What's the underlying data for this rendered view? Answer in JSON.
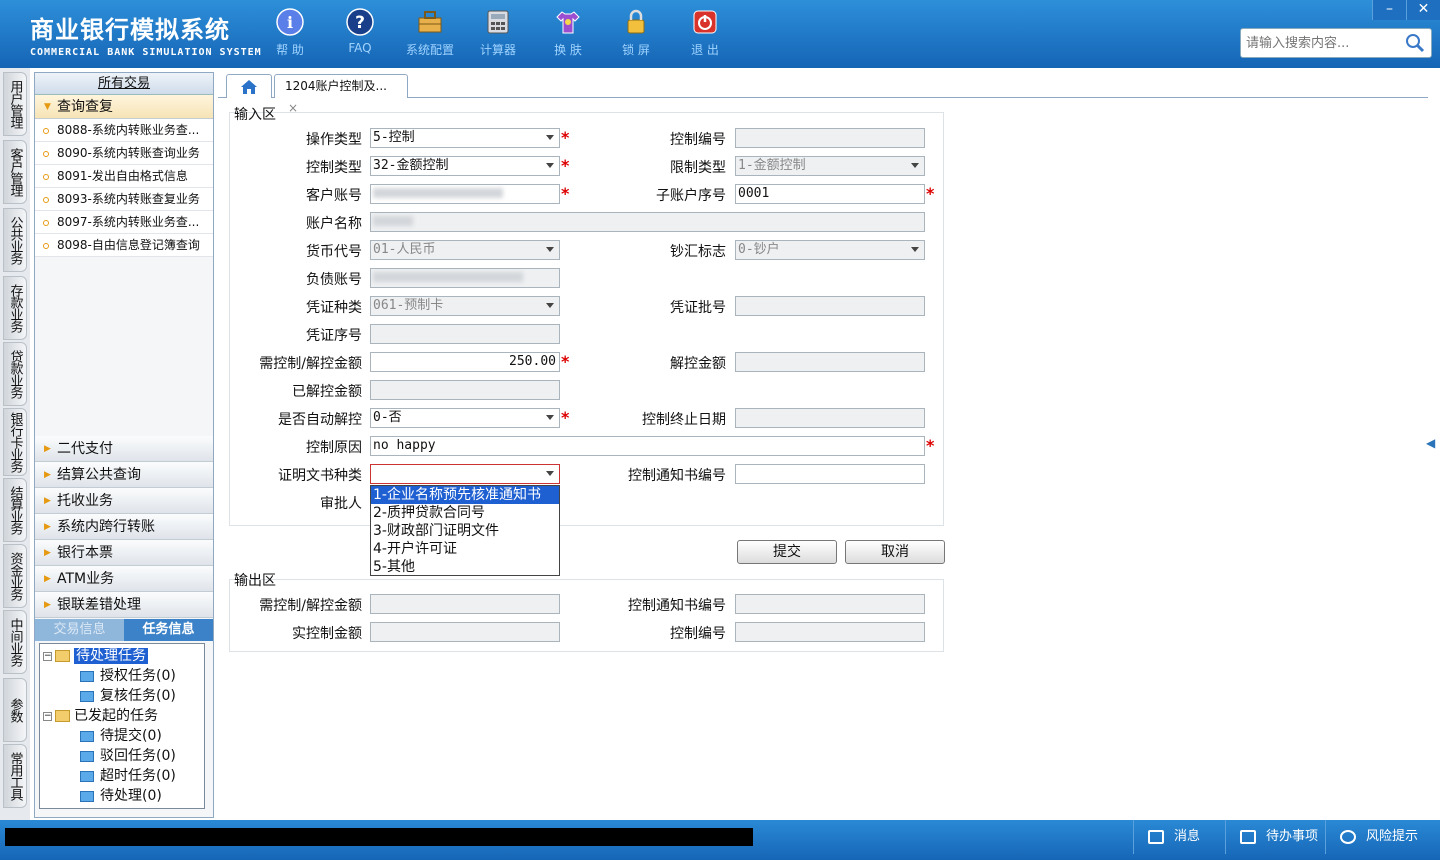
{
  "header": {
    "title_cn": "商业银行模拟系统",
    "title_en": "COMMERCIAL BANK SIMULATION SYSTEM",
    "toolbar": [
      {
        "label": "帮 助",
        "icon": "info-icon"
      },
      {
        "label": "FAQ",
        "icon": "help-icon"
      },
      {
        "label": "系统配置",
        "icon": "toolbox-icon"
      },
      {
        "label": "计算器",
        "icon": "calculator-icon"
      },
      {
        "label": "换 肤",
        "icon": "tshirt-icon"
      },
      {
        "label": "锁 屏",
        "icon": "lock-icon"
      },
      {
        "label": "退 出",
        "icon": "power-icon"
      }
    ],
    "window_controls": {
      "minimize": "–",
      "close": "✕"
    },
    "search_placeholder": "请输入搜索内容..."
  },
  "vertical_tabs": [
    "用户管理",
    "客户管理",
    "公共业务",
    "存款业务",
    "贷款业务",
    "银行卡业务",
    "结算业务",
    "资金业务",
    "中间业务",
    "参数",
    "常用工具"
  ],
  "left_panel": {
    "title": "所有交易",
    "open_group": "查询查复",
    "open_items": [
      "8088-系统内转账业务查...",
      "8090-系统内转账查询业务",
      "8091-发出自由格式信息",
      "8093-系统内转账查复业务",
      "8097-系统内转账业务查...",
      "8098-自由信息登记簿查询"
    ],
    "collapsed_groups": [
      "二代支付",
      "结算公共查询",
      "托收业务",
      "系统内跨行转账",
      "银行本票",
      "ATM业务",
      "银联差错处理"
    ],
    "task_tabs": {
      "left": "交易信息",
      "right": "任务信息"
    },
    "tree": {
      "pending": "待处理任务",
      "pending_children": [
        "授权任务(0)",
        "复核任务(0)"
      ],
      "initiated": "已发起的任务",
      "initiated_children": [
        "待提交(0)",
        "驳回任务(0)",
        "超时任务(0)",
        "待处理(0)"
      ]
    }
  },
  "tabs": {
    "active": "1204账户控制及...",
    "close": "×"
  },
  "form": {
    "input_section": "输入区",
    "output_section": "输出区",
    "labels": {
      "op_type": "操作类型",
      "ctrl_no": "控制编号",
      "ctrl_type": "控制类型",
      "limit_type": "限制类型",
      "cust_acct": "客户账号",
      "sub_acct_seq": "子账户序号",
      "acct_name": "账户名称",
      "currency": "货币代号",
      "cash_flag": "钞汇标志",
      "debt_acct": "负债账号",
      "voucher_type": "凭证种类",
      "voucher_batch": "凭证批号",
      "voucher_seq": "凭证序号",
      "ctrl_amount": "需控制/解控金额",
      "release_amount": "解控金额",
      "released_amount": "已解控金额",
      "auto_release": "是否自动解控",
      "ctrl_end_date": "控制终止日期",
      "ctrl_reason": "控制原因",
      "doc_type": "证明文书种类",
      "notice_no": "控制通知书编号",
      "approver": "审批人"
    },
    "values": {
      "op_type": "5-控制",
      "ctrl_type": "32-金额控制",
      "limit_type": "1-金额控制",
      "sub_acct_seq": "0001",
      "currency": "01-人民币",
      "cash_flag": "0-钞户",
      "voucher_type": "061-预制卡",
      "ctrl_amount": "250.00",
      "auto_release": "0-否",
      "ctrl_reason": "no happy"
    },
    "doc_type_options": [
      "1-企业名称预先核准通知书",
      "2-质押贷款合同号",
      "3-财政部门证明文件",
      "4-开户许可证",
      "5-其他"
    ],
    "buttons": {
      "submit": "提交",
      "cancel": "取消"
    },
    "output_labels": {
      "ctrl_amount": "需控制/解控金额",
      "notice_no": "控制通知书编号",
      "actual_amount": "实控制金额",
      "ctrl_no": "控制编号"
    }
  },
  "statusbar": {
    "messages": "消息",
    "todo": "待办事项",
    "risk": "风险提示"
  },
  "colors": {
    "header": "#1e78c8",
    "accent_orange": "#e69a12",
    "required": "#dd0000",
    "selected": "#1e5fd1"
  }
}
